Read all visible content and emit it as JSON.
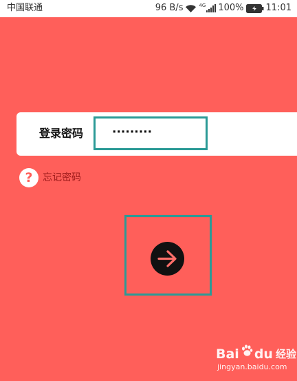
{
  "status_bar": {
    "carrier": "中国联通",
    "network_speed": "96 B/s",
    "network_type": "4G",
    "battery": "100%",
    "time": "11:01",
    "icons": [
      "wifi-icon",
      "signal-icon",
      "battery-icon"
    ]
  },
  "login": {
    "label": "登录密码",
    "password_masked": "·········"
  },
  "forgot": {
    "icon_text": "?",
    "label": "忘记密码"
  },
  "submit": {
    "icon": "arrow-right-icon"
  },
  "watermark": {
    "brand_left": "Bai",
    "brand_right": "du",
    "brand_cn": "经验",
    "url": "jingyan.baidu.com"
  },
  "colors": {
    "background": "#ff5f5a",
    "highlight": "#2b9a96",
    "forgot_text": "#9e1b1b"
  }
}
